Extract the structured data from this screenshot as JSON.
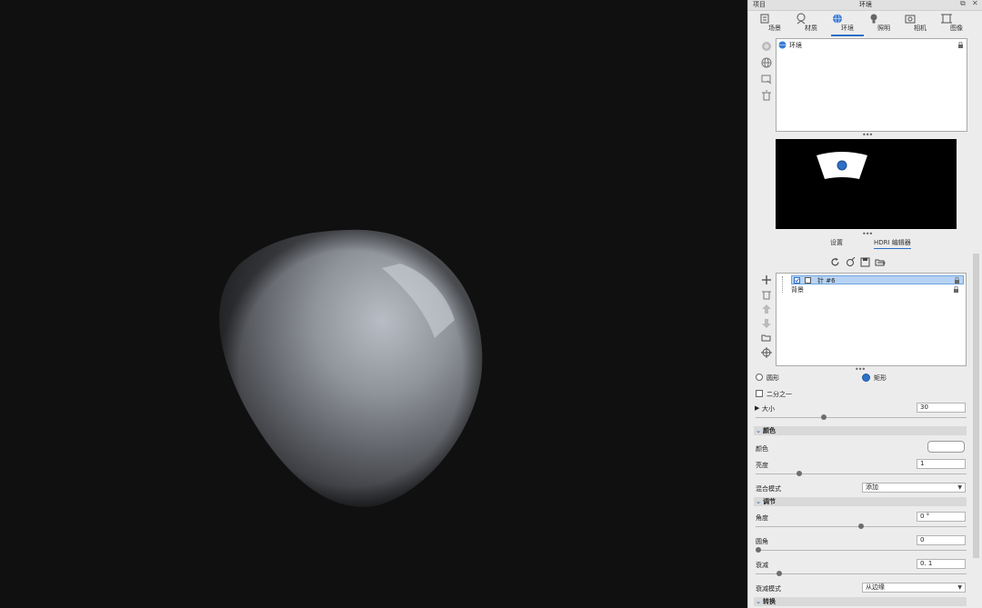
{
  "titlebar": {
    "project_label": "项目",
    "title": "环境",
    "restore_glyph": "⧉",
    "close_glyph": "✕"
  },
  "tabs": [
    {
      "label": "场景",
      "icon": "scene-icon"
    },
    {
      "label": "材质",
      "icon": "material-icon"
    },
    {
      "label": "环境",
      "icon": "environment-icon",
      "active": true
    },
    {
      "label": "照明",
      "icon": "lighting-icon"
    },
    {
      "label": "相机",
      "icon": "camera-icon"
    },
    {
      "label": "图像",
      "icon": "image-icon"
    }
  ],
  "environment_list": {
    "items": [
      {
        "label": "环境",
        "icon": "globe-icon"
      }
    ]
  },
  "dots": "•••",
  "subtabs": {
    "settings": "设置",
    "hdri_editor": "HDRI 编辑器"
  },
  "pin_list": {
    "items": [
      {
        "label": "针 #6",
        "checked": true
      },
      {
        "label": "背景",
        "checked": false
      }
    ]
  },
  "shape": {
    "circle_label": "圆形",
    "rect_label": "矩形",
    "selected": "矩形"
  },
  "half_label": "二分之一",
  "size": {
    "label": "大小",
    "value": "30",
    "slider": 0.42
  },
  "color_section": {
    "title": "颜色",
    "color_label": "颜色",
    "color_value": "#ffffff",
    "brightness_label": "亮度",
    "brightness_value": "1",
    "brightness_slider": 0.2,
    "blend_label": "混合模式",
    "blend_value": "添加"
  },
  "adjust_section": {
    "title": "调节",
    "angle_label": "角度",
    "angle_value": "0 °",
    "angle_slider": 0.5,
    "corner_label": "圆角",
    "corner_value": "0",
    "corner_slider": 0.0,
    "falloff_label": "衰减",
    "falloff_value": "0. 1",
    "falloff_slider": 0.1,
    "falloff_mode_label": "衰减模式",
    "falloff_mode_value": "从边缘"
  },
  "transform_section": {
    "title": "转换"
  },
  "colors": {
    "accent": "#2e6fc7",
    "viewport_bg": "#101011",
    "panel_bg": "#ececec"
  }
}
